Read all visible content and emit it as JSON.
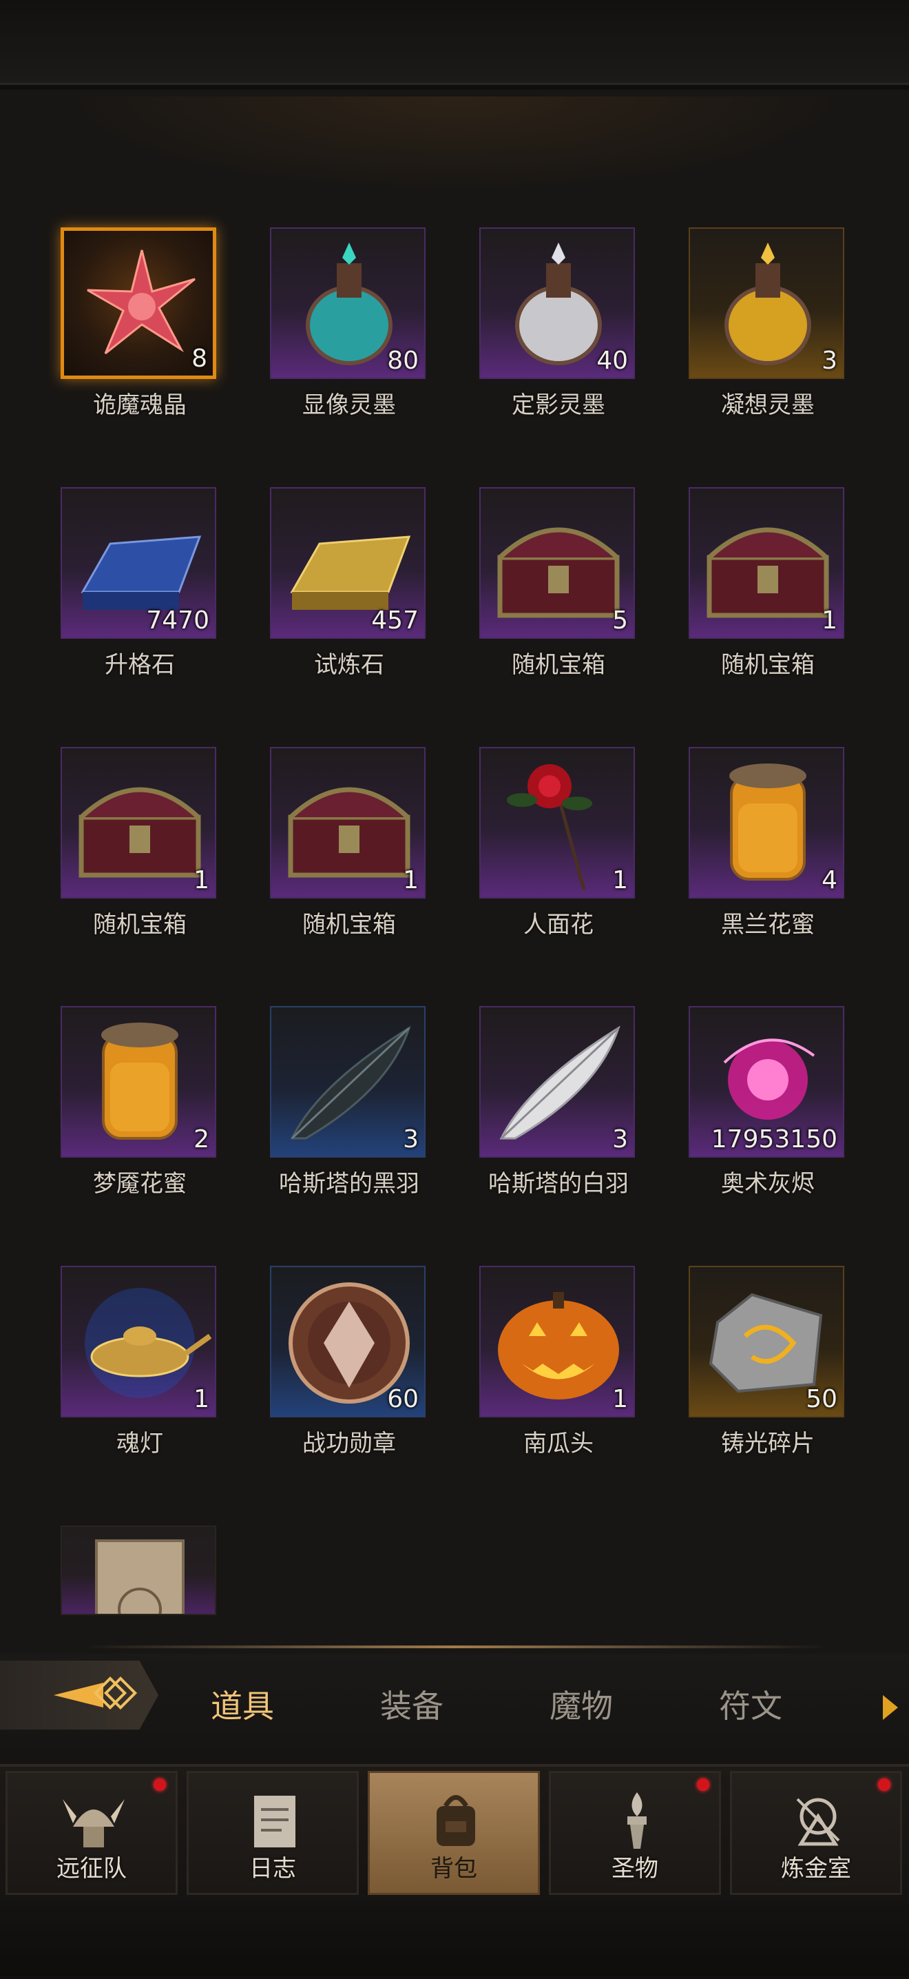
{
  "inventory": {
    "items": [
      {
        "name": "诡魔魂晶",
        "count": "8",
        "rarity": "legendary",
        "icon": "crystal-star-icon"
      },
      {
        "name": "显像灵墨",
        "count": "80",
        "rarity": "purple",
        "icon": "teal-potion-icon"
      },
      {
        "name": "定影灵墨",
        "count": "40",
        "rarity": "purple",
        "icon": "silver-potion-icon"
      },
      {
        "name": "凝想灵墨",
        "count": "3",
        "rarity": "gold",
        "icon": "gold-potion-icon"
      },
      {
        "name": "升格石",
        "count": "7470",
        "rarity": "purple",
        "icon": "blue-ingot-icon"
      },
      {
        "name": "试炼石",
        "count": "457",
        "rarity": "purple",
        "icon": "gold-ingot-icon"
      },
      {
        "name": "随机宝箱",
        "count": "5",
        "rarity": "purple",
        "icon": "treasure-chest-icon"
      },
      {
        "name": "随机宝箱",
        "count": "1",
        "rarity": "purple",
        "icon": "treasure-chest-icon"
      },
      {
        "name": "随机宝箱",
        "count": "1",
        "rarity": "purple",
        "icon": "treasure-chest-icon"
      },
      {
        "name": "随机宝箱",
        "count": "1",
        "rarity": "purple",
        "icon": "treasure-chest-icon"
      },
      {
        "name": "人面花",
        "count": "1",
        "rarity": "purple",
        "icon": "rose-icon"
      },
      {
        "name": "黑兰花蜜",
        "count": "4",
        "rarity": "purple",
        "icon": "honey-jar-icon"
      },
      {
        "name": "梦魇花蜜",
        "count": "2",
        "rarity": "purple",
        "icon": "honey-jar-icon"
      },
      {
        "name": "哈斯塔的黑羽",
        "count": "3",
        "rarity": "blue",
        "icon": "black-feather-icon"
      },
      {
        "name": "哈斯塔的白羽",
        "count": "3",
        "rarity": "purple",
        "icon": "white-feather-icon"
      },
      {
        "name": "奥术灰烬",
        "count": "17953150",
        "rarity": "purple",
        "icon": "arcane-orb-icon"
      },
      {
        "name": "魂灯",
        "count": "1",
        "rarity": "purple",
        "icon": "magic-lamp-icon"
      },
      {
        "name": "战功勋章",
        "count": "60",
        "rarity": "blue",
        "icon": "medal-icon"
      },
      {
        "name": "南瓜头",
        "count": "1",
        "rarity": "purple",
        "icon": "pumpkin-icon"
      },
      {
        "name": "铸光碎片",
        "count": "50",
        "rarity": "gold",
        "icon": "rune-stone-icon"
      },
      {
        "name": "",
        "count": "",
        "rarity": "plain",
        "icon": "scroll-icon"
      }
    ]
  },
  "tabs": [
    {
      "label": "道具",
      "active": true
    },
    {
      "label": "装备",
      "active": false
    },
    {
      "label": "魔物",
      "active": false
    },
    {
      "label": "符文",
      "active": false
    }
  ],
  "nav": [
    {
      "label": "远征队",
      "icon": "viking-helmet-icon",
      "badge": true,
      "active": false
    },
    {
      "label": "日志",
      "icon": "journal-icon",
      "badge": false,
      "active": false
    },
    {
      "label": "背包",
      "icon": "backpack-icon",
      "badge": false,
      "active": true
    },
    {
      "label": "圣物",
      "icon": "relic-torch-icon",
      "badge": true,
      "active": false
    },
    {
      "label": "炼金室",
      "icon": "alchemy-icon",
      "badge": true,
      "active": false
    }
  ],
  "colors": {
    "legendary_border": "#e08a12",
    "purple_rarity": "#5a2a7a",
    "blue_rarity": "#23427a",
    "gold_rarity": "#6a4a14",
    "active_tab": "#f1c57a",
    "badge": "#d4141c"
  }
}
